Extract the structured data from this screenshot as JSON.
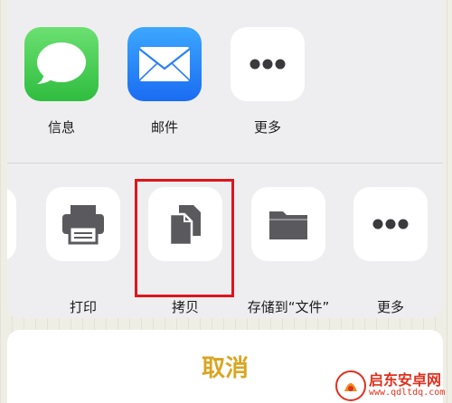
{
  "share_apps": [
    {
      "label": "信息",
      "icon": "messages-icon"
    },
    {
      "label": "邮件",
      "icon": "mail-icon"
    },
    {
      "label": "更多",
      "icon": "more-dots-icon"
    }
  ],
  "actions": [
    {
      "label": "打印",
      "icon": "printer-icon"
    },
    {
      "label": "拷贝",
      "icon": "copy-icon"
    },
    {
      "label": "存储到“文件”",
      "icon": "folder-icon"
    },
    {
      "label": "更多",
      "icon": "more-dots-icon"
    }
  ],
  "cancel_label": "取消",
  "watermark": {
    "title": "启东安卓网",
    "url": "www.qdltdq.com"
  },
  "colors": {
    "highlight": "#e0141b",
    "cancel_text": "#d9a520",
    "icon_gray": "#5a5a5e"
  }
}
